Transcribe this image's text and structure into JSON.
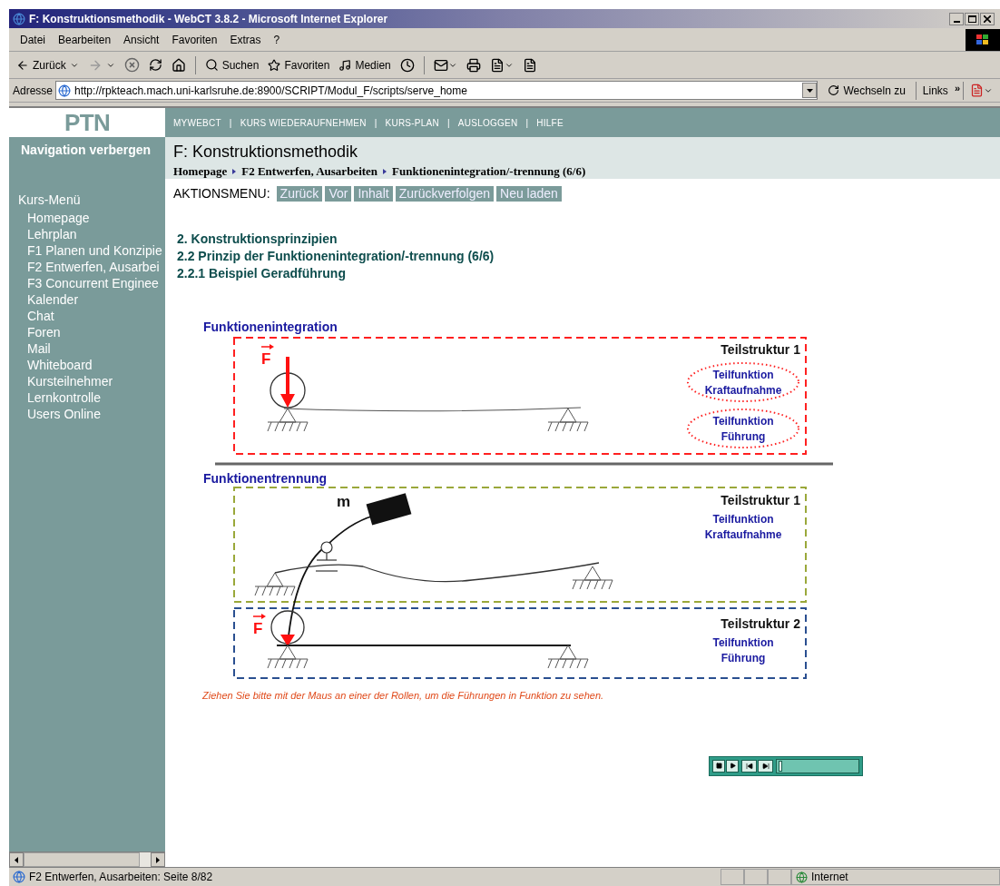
{
  "window": {
    "title": "F: Konstruktionsmethodik - WebCT 3.8.2 - Microsoft Internet Explorer"
  },
  "menu_bar": [
    "Datei",
    "Bearbeiten",
    "Ansicht",
    "Favoriten",
    "Extras",
    "?"
  ],
  "toolbar": {
    "back": "Zurück",
    "search": "Suchen",
    "favorites": "Favoriten",
    "media": "Medien"
  },
  "address_bar": {
    "label": "Adresse",
    "url": "http://rpkteach.mach.uni-karlsruhe.de:8900/SCRIPT/Modul_F/scripts/serve_home",
    "go": "Wechseln zu",
    "links": "Links",
    "chevron": "»"
  },
  "logo": "PTN",
  "top_nav": {
    "separator": "|",
    "items": [
      "MYWEBCT",
      "KURS WIEDERAUFNEHMEN",
      "KURS-PLAN",
      "AUSLOGGEN",
      "HILFE"
    ]
  },
  "sidebar": {
    "toggle": "Navigation verbergen",
    "menu_title": "Kurs-Menü",
    "items": [
      "Homepage",
      "Lehrplan",
      "F1 Planen und Konzipie",
      "F2 Entwerfen, Ausarbei",
      "F3 Concurrent Enginee",
      "Kalender",
      "Chat",
      "Foren",
      "Mail",
      "Whiteboard",
      "Kursteilnehmer",
      "Lernkontrolle",
      "Users Online"
    ]
  },
  "header": {
    "title": "F: Konstruktionsmethodik",
    "breadcrumb": [
      "Homepage",
      "F2 Entwerfen, Ausarbeiten",
      "Funktionenintegration/-trennung (6/6)"
    ]
  },
  "action_menu": {
    "label": "AKTIONSMENU:",
    "buttons": [
      "Zurück",
      "Vor",
      "Inhalt",
      "Zurückverfolgen",
      "Neu laden"
    ]
  },
  "headings": [
    "2. Konstruktionsprinzipien",
    "2.2 Prinzip der Funktionenintegration/-trennung (6/6)",
    "2.2.1 Beispiel Geradführung"
  ],
  "diagram": {
    "integration": {
      "title": "Funktionenintegration",
      "force": "F",
      "structure": "Teilstruktur 1",
      "functions": [
        [
          "Teilfunktion",
          "Kraftaufnahme"
        ],
        [
          "Teilfunktion",
          "Führung"
        ]
      ]
    },
    "separation": {
      "title": "Funktionentrennung",
      "mass": "m",
      "force": "F",
      "structures": [
        {
          "label": "Teilstruktur 1",
          "function": [
            "Teilfunktion",
            "Kraftaufnahme"
          ]
        },
        {
          "label": "Teilstruktur 2",
          "function": [
            "Teilfunktion",
            "Führung"
          ]
        }
      ]
    }
  },
  "caption": "Ziehen Sie bitte mit der Maus an einer der Rollen, um die Führungen in Funktion zu sehen.",
  "player": {
    "level": 0.02
  },
  "status_bar": {
    "text": "F2 Entwerfen, Ausarbeiten: Seite 8/82",
    "zone": "Internet"
  }
}
